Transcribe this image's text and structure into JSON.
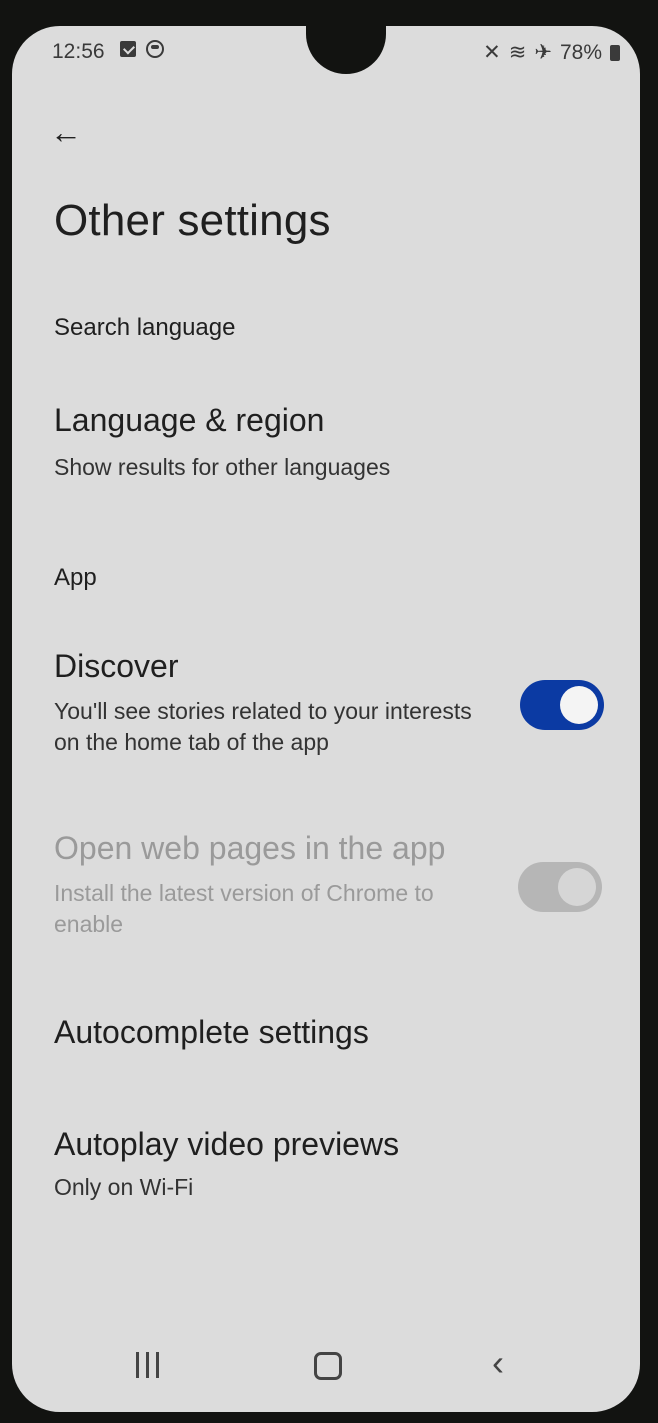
{
  "status_bar": {
    "time": "12:56",
    "battery": "78%",
    "icons": [
      "checkbox-icon",
      "circle-icon",
      "mute-icon",
      "wifi-icon",
      "airplane-icon",
      "battery-icon"
    ]
  },
  "header": {
    "back_glyph": "←",
    "title": "Other settings"
  },
  "sections": {
    "search_language": "Search language",
    "app": "App"
  },
  "items": {
    "language_region": {
      "title": "Language & region",
      "subtitle": "Show results for other languages"
    },
    "discover": {
      "title": "Discover",
      "subtitle": "You'll see stories related to your interests on the home tab of the app",
      "enabled": true
    },
    "open_web_pages": {
      "title": "Open web pages in the app",
      "subtitle": "Install the latest version of Chrome to enable",
      "enabled": false,
      "disabled": true
    },
    "autocomplete": {
      "title": "Autocomplete settings"
    },
    "autoplay": {
      "title": "Autoplay video previews",
      "subtitle": "Only on Wi-Fi"
    }
  },
  "nav": {
    "back_glyph": "‹"
  },
  "colors": {
    "toggle_on": "#0b3aa3",
    "background": "#dcdcdc"
  }
}
